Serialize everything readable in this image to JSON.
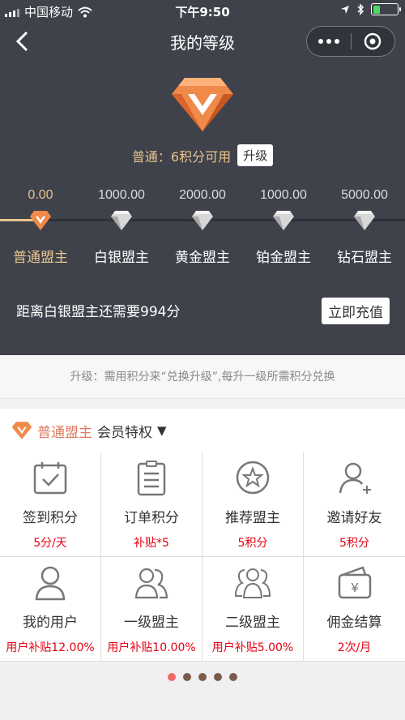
{
  "status": {
    "carrier": "中国移动",
    "time": "下午9:50",
    "battery_level": 0.3
  },
  "nav": {
    "title": "我的等级"
  },
  "current": {
    "level_text": "普通：6积分可用",
    "upgrade_label": "升级"
  },
  "levels": [
    {
      "value": "0.00",
      "name": "普通盟主",
      "active": true
    },
    {
      "value": "1000.00",
      "name": "白银盟主"
    },
    {
      "value": "2000.00",
      "name": "黄金盟主"
    },
    {
      "value": "1000.00",
      "name": "铂金盟主"
    },
    {
      "value": "5000.00",
      "name": "钻石盟主"
    }
  ],
  "progress": {
    "need_text": "距离白银盟主还需要994分",
    "recharge_label": "立即充值"
  },
  "notice": "升级：需用积分来“兑换升级”,每升一级所需积分兑换",
  "privileges": {
    "level": "普通盟主",
    "label": "会员特权",
    "arrow": "▼",
    "items": [
      {
        "icon": "calendar-check-icon",
        "title": "签到积分",
        "value": "5分/天"
      },
      {
        "icon": "order-list-icon",
        "title": "订单积分",
        "value": "补贴*5"
      },
      {
        "icon": "star-badge-icon",
        "title": "推荐盟主",
        "value": "5积分"
      },
      {
        "icon": "user-add-icon",
        "title": "邀请好友",
        "value": "5积分"
      },
      {
        "icon": "user-icon",
        "title": "我的用户",
        "value": "用户补贴12.00%"
      },
      {
        "icon": "two-users-icon",
        "title": "一级盟主",
        "value": "用户补贴10.00%"
      },
      {
        "icon": "three-users-icon",
        "title": "二级盟主",
        "value": "用户补贴5.00%"
      },
      {
        "icon": "wallet-icon",
        "title": "佣金结算",
        "value": "2次/月"
      }
    ]
  },
  "carousel": {
    "page_count": 5,
    "active_page": 1
  },
  "colors": {
    "dark_bg": "#3f424b",
    "gold": "#e8c48c",
    "red": "#e60012",
    "bronze": "#e8773f"
  }
}
